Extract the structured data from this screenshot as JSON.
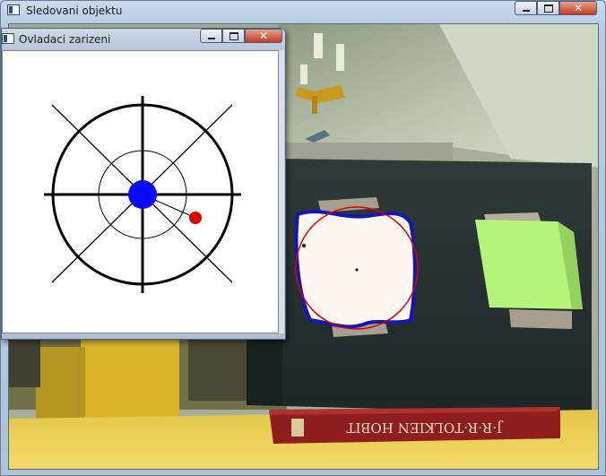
{
  "main_window": {
    "title": "Sledovani objektu",
    "controls": {
      "minimize": "minimize",
      "maximize": "maximize",
      "close": "close"
    }
  },
  "camera_view": {
    "book_spine_text": "J·R·R·TOLKIEN   HOBIT"
  },
  "control_window": {
    "title": "Ovladaci zarizeni"
  },
  "icons": {
    "app_icon": "window-app-icon",
    "minimize": "minimize-icon",
    "maximize": "maximize-icon",
    "close": "close-icon"
  },
  "colors": {
    "center_dot": "#0a0aff",
    "target_dot": "#e00000",
    "contour": "#1616b8",
    "fit_circle": "#e00000",
    "green_note": "#b6f37a"
  }
}
